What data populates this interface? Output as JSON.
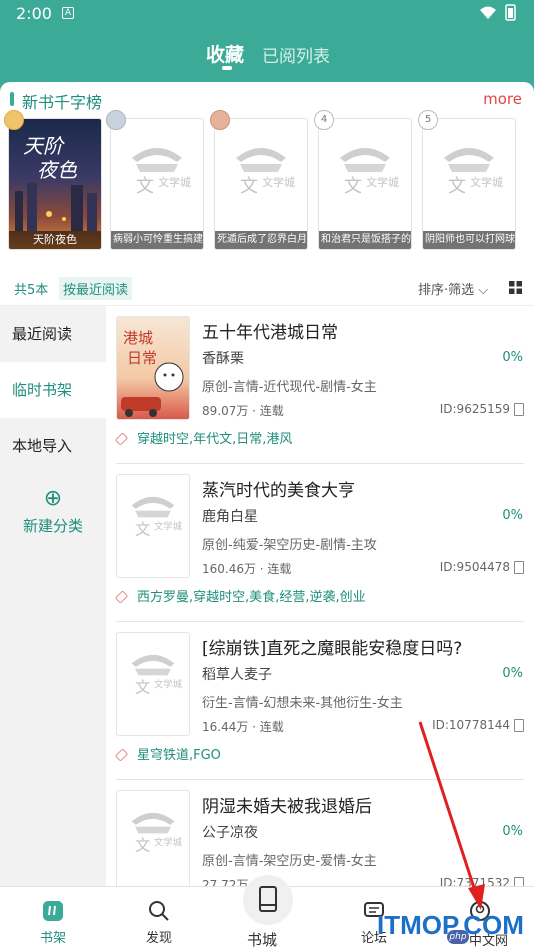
{
  "status_bar": {
    "time": "2:00",
    "indicator": "A"
  },
  "header": {
    "tab_active": "收藏",
    "tab_inactive": "已阅列表"
  },
  "ranking": {
    "title": "新书千字榜",
    "more": "more",
    "covers": [
      {
        "rank": "",
        "title": "天阶夜色",
        "style": "illustrated"
      },
      {
        "rank": "",
        "title": "病弱小可怜重生搞建",
        "style": "placeholder"
      },
      {
        "rank": "",
        "title": "死遁后成了忍界白月",
        "style": "placeholder"
      },
      {
        "rank": "4",
        "title": "和治君只是饭搭子的",
        "style": "placeholder"
      },
      {
        "rank": "5",
        "title": "阴阳师也可以打网球",
        "style": "placeholder"
      }
    ]
  },
  "shelf_bar": {
    "count": "共5本",
    "sort_mode": "按最近阅读",
    "filter": "排序·筛选"
  },
  "sidebar": {
    "items": [
      "最近阅读",
      "临时书架",
      "本地导入"
    ],
    "new_category": "新建分类"
  },
  "books": [
    {
      "title": "五十年代港城日常",
      "author": "香酥栗",
      "progress": "0%",
      "genre": "原创-言情-近代现代-剧情-女主",
      "words": "89.07万 · 连载",
      "id": "ID:9625159",
      "tags": "穿越时空,年代文,日常,港风"
    },
    {
      "title": "蒸汽时代的美食大亨",
      "author": "鹿角白星",
      "progress": "0%",
      "genre": "原创-纯爱-架空历史-剧情-主攻",
      "words": "160.46万 · 连载",
      "id": "ID:9504478",
      "tags": "西方罗曼,穿越时空,美食,经营,逆袭,创业"
    },
    {
      "title": "[综崩铁]直死之魔眼能安稳度日吗?",
      "author": "稻草人麦子",
      "progress": "0%",
      "genre": "衍生-言情-幻想未来-其他衍生-女主",
      "words": "16.44万 · 连载",
      "id": "ID:10778144",
      "tags": "星穹铁道,FGO"
    },
    {
      "title": "阴湿未婚夫被我退婚后",
      "author": "公子凉夜",
      "progress": "0%",
      "genre": "原创-言情-架空历史-爱情-女主",
      "words": "27.72万 · 连载",
      "id": "ID:7371532",
      "tags": ""
    }
  ],
  "bottom_nav": {
    "shelf": "书架",
    "discover": "发现",
    "store": "书城",
    "forum": "论坛",
    "mine": ""
  },
  "watermark": {
    "main": "ITMOP.COM",
    "sub": "中文网",
    "php": "php"
  },
  "colors": {
    "accent": "#3bab97",
    "accent_text": "#1f8f7c",
    "more": "#e04848",
    "arrow": "#e02020"
  }
}
